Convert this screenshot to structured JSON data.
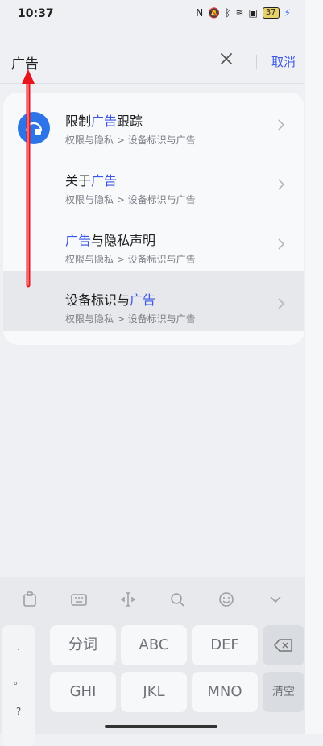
{
  "status": {
    "time": "10:37",
    "icons": [
      "nfc-icon",
      "mute-icon",
      "bluetooth-icon",
      "wifi-icon",
      "sim-icon"
    ],
    "battery": "37"
  },
  "search": {
    "value": "广告",
    "cancel_label": "取消"
  },
  "results": [
    {
      "pre": "限制",
      "hl": "广告",
      "post": "跟踪",
      "sub": "权限与隐私 > 设备标识与广告",
      "has_icon": true
    },
    {
      "pre": "关于",
      "hl": "广告",
      "post": "",
      "sub": "权限与隐私 > 设备标识与广告",
      "has_icon": false
    },
    {
      "pre": "",
      "hl": "广告",
      "post": "与隐私声明",
      "sub": "权限与隐私 > 设备标识与广告",
      "has_icon": false
    },
    {
      "pre": "设备标识与",
      "hl": "广告",
      "post": "",
      "sub": "权限与隐私 > 设备标识与广告",
      "has_icon": false,
      "selected": true
    }
  ],
  "keyboard": {
    "toolbar": [
      "clipboard-icon",
      "keyboard-icon",
      "cursor-icon",
      "search-icon",
      "emoji-icon",
      "collapse-icon"
    ],
    "side": [
      ".",
      "。",
      "?"
    ],
    "row1": [
      "分词",
      "ABC",
      "DEF"
    ],
    "row2": [
      "GHI",
      "JKL",
      "MNO"
    ],
    "clear_label": "清空"
  },
  "colors": {
    "accent": "#3b55e6",
    "icon_bg": "#2d74e8",
    "arrow": "#e8141c"
  }
}
